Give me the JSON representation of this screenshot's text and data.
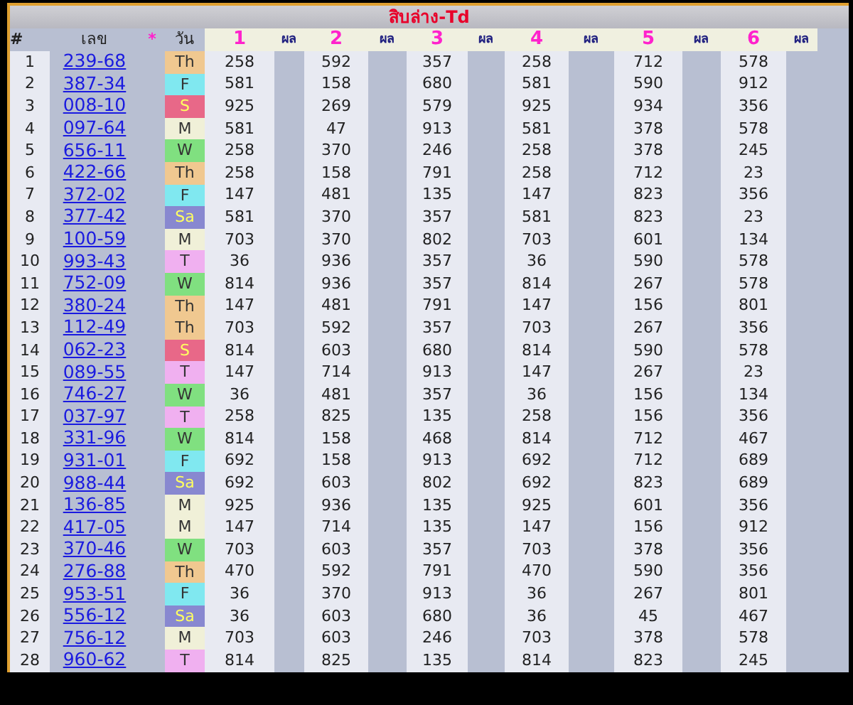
{
  "title": "สิบล่าง-Td",
  "columns": [
    {
      "label": "#",
      "kind": "index"
    },
    {
      "label": "เลข",
      "kind": "number"
    },
    {
      "label": "*",
      "kind": "mark"
    },
    {
      "label": "วัน",
      "kind": "day"
    },
    {
      "label": "1",
      "kind": "value"
    },
    {
      "label": "ผล",
      "kind": "result"
    },
    {
      "label": "2",
      "kind": "value"
    },
    {
      "label": "ผล",
      "kind": "result"
    },
    {
      "label": "3",
      "kind": "value"
    },
    {
      "label": "ผล",
      "kind": "result"
    },
    {
      "label": "4",
      "kind": "value"
    },
    {
      "label": "ผล",
      "kind": "result"
    },
    {
      "label": "5",
      "kind": "value"
    },
    {
      "label": "ผล",
      "kind": "result"
    },
    {
      "label": "6",
      "kind": "value"
    },
    {
      "label": "ผล",
      "kind": "result"
    }
  ],
  "rows": [
    {
      "no": "1",
      "number": "239-68",
      "day": "Th",
      "color": "#f0c890",
      "values": [
        "258",
        "592",
        "357",
        "258",
        "712",
        "578"
      ]
    },
    {
      "no": "2",
      "number": "387-34",
      "day": "F",
      "color": "#80e8f0",
      "values": [
        "581",
        "158",
        "680",
        "581",
        "590",
        "912"
      ]
    },
    {
      "no": "3",
      "number": "008-10",
      "day": "S",
      "color": "#e86888",
      "values": [
        "925",
        "269",
        "579",
        "925",
        "934",
        "356"
      ]
    },
    {
      "no": "4",
      "number": "097-64",
      "day": "M",
      "color": "#f0f0d8",
      "values": [
        "581",
        "47",
        "913",
        "581",
        "378",
        "578"
      ]
    },
    {
      "no": "5",
      "number": "656-11",
      "day": "W",
      "color": "#80e080",
      "values": [
        "258",
        "370",
        "246",
        "258",
        "378",
        "245"
      ]
    },
    {
      "no": "6",
      "number": "422-66",
      "day": "Th",
      "color": "#f0c890",
      "values": [
        "258",
        "158",
        "791",
        "258",
        "712",
        "23"
      ]
    },
    {
      "no": "7",
      "number": "372-02",
      "day": "F",
      "color": "#80e8f0",
      "values": [
        "147",
        "481",
        "135",
        "147",
        "823",
        "356"
      ]
    },
    {
      "no": "8",
      "number": "377-42",
      "day": "Sa",
      "color": "#8888d0",
      "values": [
        "581",
        "370",
        "357",
        "581",
        "823",
        "23"
      ]
    },
    {
      "no": "9",
      "number": "100-59",
      "day": "M",
      "color": "#f0f0d8",
      "values": [
        "703",
        "370",
        "802",
        "703",
        "601",
        "134"
      ]
    },
    {
      "no": "10",
      "number": "993-43",
      "day": "T",
      "color": "#f0b0f0",
      "values": [
        "36",
        "936",
        "357",
        "36",
        "590",
        "578"
      ]
    },
    {
      "no": "11",
      "number": "752-09",
      "day": "W",
      "color": "#80e080",
      "values": [
        "814",
        "936",
        "357",
        "814",
        "267",
        "578"
      ]
    },
    {
      "no": "12",
      "number": "380-24",
      "day": "Th",
      "color": "#f0c890",
      "values": [
        "147",
        "481",
        "791",
        "147",
        "156",
        "801"
      ]
    },
    {
      "no": "13",
      "number": "112-49",
      "day": "Th",
      "color": "#f0c890",
      "values": [
        "703",
        "592",
        "357",
        "703",
        "267",
        "356"
      ]
    },
    {
      "no": "14",
      "number": "062-23",
      "day": "S",
      "color": "#e86888",
      "values": [
        "814",
        "603",
        "680",
        "814",
        "590",
        "578"
      ]
    },
    {
      "no": "15",
      "number": "089-55",
      "day": "T",
      "color": "#f0b0f0",
      "values": [
        "147",
        "714",
        "913",
        "147",
        "267",
        "23"
      ]
    },
    {
      "no": "16",
      "number": "746-27",
      "day": "W",
      "color": "#80e080",
      "values": [
        "36",
        "481",
        "357",
        "36",
        "156",
        "134"
      ]
    },
    {
      "no": "17",
      "number": "037-97",
      "day": "T",
      "color": "#f0b0f0",
      "values": [
        "258",
        "825",
        "135",
        "258",
        "156",
        "356"
      ]
    },
    {
      "no": "18",
      "number": "331-96",
      "day": "W",
      "color": "#80e080",
      "values": [
        "814",
        "158",
        "468",
        "814",
        "712",
        "467"
      ]
    },
    {
      "no": "19",
      "number": "931-01",
      "day": "F",
      "color": "#80e8f0",
      "values": [
        "692",
        "158",
        "913",
        "692",
        "712",
        "689"
      ]
    },
    {
      "no": "20",
      "number": "988-44",
      "day": "Sa",
      "color": "#8888d0",
      "values": [
        "692",
        "603",
        "802",
        "692",
        "823",
        "689"
      ]
    },
    {
      "no": "21",
      "number": "136-85",
      "day": "M",
      "color": "#f0f0d8",
      "values": [
        "925",
        "936",
        "135",
        "925",
        "601",
        "356"
      ]
    },
    {
      "no": "22",
      "number": "417-05",
      "day": "M",
      "color": "#f0f0d8",
      "values": [
        "147",
        "714",
        "135",
        "147",
        "156",
        "912"
      ]
    },
    {
      "no": "23",
      "number": "370-46",
      "day": "W",
      "color": "#80e080",
      "values": [
        "703",
        "603",
        "357",
        "703",
        "378",
        "356"
      ]
    },
    {
      "no": "24",
      "number": "276-88",
      "day": "Th",
      "color": "#f0c890",
      "values": [
        "470",
        "592",
        "791",
        "470",
        "590",
        "356"
      ]
    },
    {
      "no": "25",
      "number": "953-51",
      "day": "F",
      "color": "#80e8f0",
      "values": [
        "36",
        "370",
        "913",
        "36",
        "267",
        "801"
      ]
    },
    {
      "no": "26",
      "number": "556-12",
      "day": "Sa",
      "color": "#8888d0",
      "values": [
        "36",
        "603",
        "680",
        "36",
        "45",
        "467"
      ]
    },
    {
      "no": "27",
      "number": "756-12",
      "day": "M",
      "color": "#f0f0d8",
      "values": [
        "703",
        "603",
        "246",
        "703",
        "378",
        "578"
      ]
    },
    {
      "no": "28",
      "number": "960-62",
      "day": "T",
      "color": "#f0b0f0",
      "values": [
        "814",
        "825",
        "135",
        "814",
        "823",
        "245"
      ]
    }
  ]
}
